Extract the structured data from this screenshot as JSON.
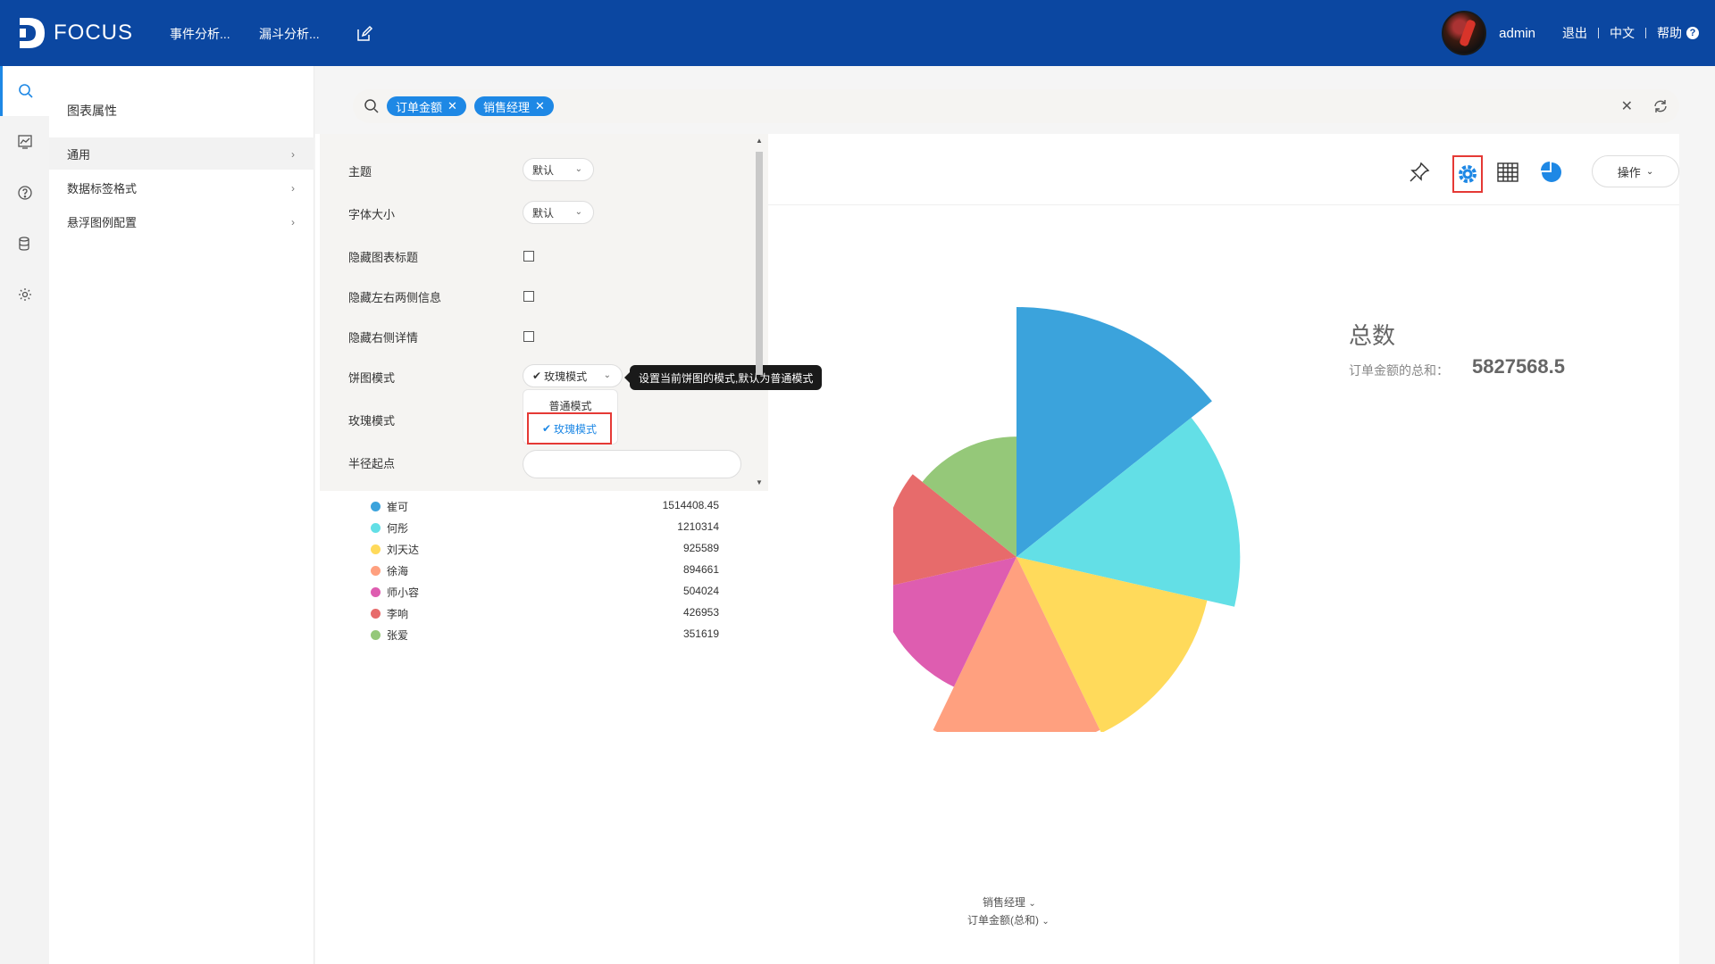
{
  "app": {
    "logo_text": "FOCUS",
    "nav": [
      "事件分析...",
      "漏斗分析..."
    ],
    "user_name": "admin",
    "links": [
      "退出",
      "中文",
      "帮助"
    ]
  },
  "sidebar": {
    "title": "图表属性",
    "items": [
      {
        "label": "通用"
      },
      {
        "label": "数据标签格式"
      },
      {
        "label": "悬浮图例配置"
      }
    ]
  },
  "search": {
    "chips": [
      "订单金额",
      "销售经理"
    ]
  },
  "toolbar": {
    "ops_label": "操作"
  },
  "settings": {
    "theme_label": "主题",
    "theme_value": "默认",
    "font_size_label": "字体大小",
    "font_size_value": "默认",
    "hide_title_label": "隐藏图表标题",
    "hide_side_info_label": "隐藏左右两侧信息",
    "hide_right_detail_label": "隐藏右侧详情",
    "pie_mode_label": "饼图模式",
    "pie_mode_value": "玫瑰模式",
    "pie_mode_tooltip": "设置当前饼图的模式,默认为普通模式",
    "pie_mode_options": [
      "普通模式",
      "玫瑰模式"
    ],
    "rose_mode_label": "玫瑰模式",
    "radius_start_label": "半径起点"
  },
  "chart_data": {
    "type": "pie",
    "categories": [
      "崔可",
      "何彤",
      "刘天达",
      "徐海",
      "师小容",
      "李响",
      "张爱"
    ],
    "values": [
      1514408.45,
      1210314,
      925589,
      894661,
      504024,
      426953,
      351619
    ],
    "value_labels": [
      "1514408.45",
      "1210314",
      "925589",
      "894661",
      "504024",
      "426953",
      "351619"
    ],
    "colors": [
      "#3ba3dc",
      "#63dfe6",
      "#ffda5b",
      "#ffa07f",
      "#de5db0",
      "#e76b6b",
      "#95c879"
    ],
    "rose_mode": true,
    "summary_title": "总数",
    "summary_label": "订单金额的总和：",
    "summary_value": "5827568.5",
    "xlabel": "销售经理",
    "ylabel": "订单金额(总和)"
  }
}
